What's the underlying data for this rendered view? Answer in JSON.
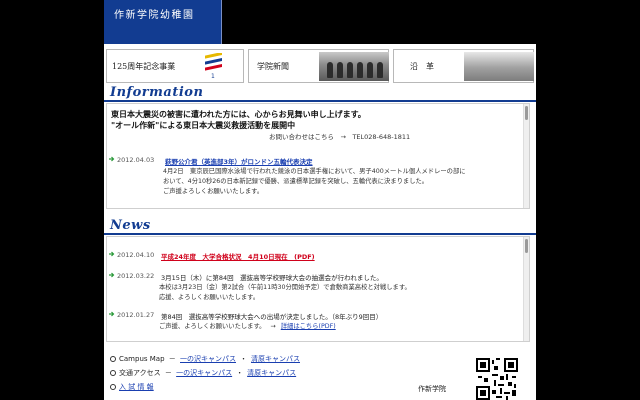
{
  "header": {
    "school_title": "作新学院幼稚園"
  },
  "banners": [
    {
      "label": "125周年記念事業"
    },
    {
      "label": "学院新聞"
    },
    {
      "label": "沿　革"
    }
  ],
  "information": {
    "heading": "Information",
    "notice_line1": "東日本大震災の被害に遭われた方には、心からお見舞い申し上げます。",
    "notice_line2": "\"オール作新\"による東日本大震災救援活動を展開中",
    "contact_label": "お問い合わせはこちら　→　TEL028-648-1811",
    "items": [
      {
        "date": "2012.04.03",
        "headline": "萩野公介君（英進部3年）がロンドン五輪代表決定",
        "body": [
          "4月2日　東京辰巳国際水泳場で行われた競泳の日本選手権において、男子400メートル個人メドレーの部に",
          "おいて、4分10秒26の日本新記録で優勝、派遣標準記録を突破し、五輪代表に決まりました。",
          "ご声援よろしくお願いいたします。"
        ]
      }
    ]
  },
  "news": {
    "heading": "News",
    "items": [
      {
        "date": "2012.04.10",
        "headline": "平成24年度　大学合格状況　4月10日現在　(PDF)",
        "body": []
      },
      {
        "date": "2012.03.22",
        "headline": "3月15日（木）に第84回　選抜高等学校野球大会の抽選会が行われました。",
        "body": [
          "本校は3月23日（金）第2試合（午前11時30分開始予定）で倉敷商業高校と対戦します。",
          "応援、よろしくお願いいたします。"
        ]
      },
      {
        "date": "2012.01.27",
        "headline": "第84回　選抜高等学校野球大会への出場が決定しました。（8年ぶり9回目）",
        "body": [
          "ご声援、よろしくお願いいたします。",
          "詳細はこちら(PDF)"
        ]
      }
    ]
  },
  "footer": {
    "campus_map_label": "Campus Map",
    "access_label": "交通アクセス",
    "admission_label": "入 試 情 報",
    "campus_ichinosawa": "一の沢キャンパス",
    "campus_kiyohara": "清原キャンパス",
    "separator": "・",
    "school_name": "作新学院"
  },
  "colors": {
    "brand_blue": "#123c91",
    "link_blue": "#1a3fb0",
    "alert_red": "#d0011b"
  }
}
